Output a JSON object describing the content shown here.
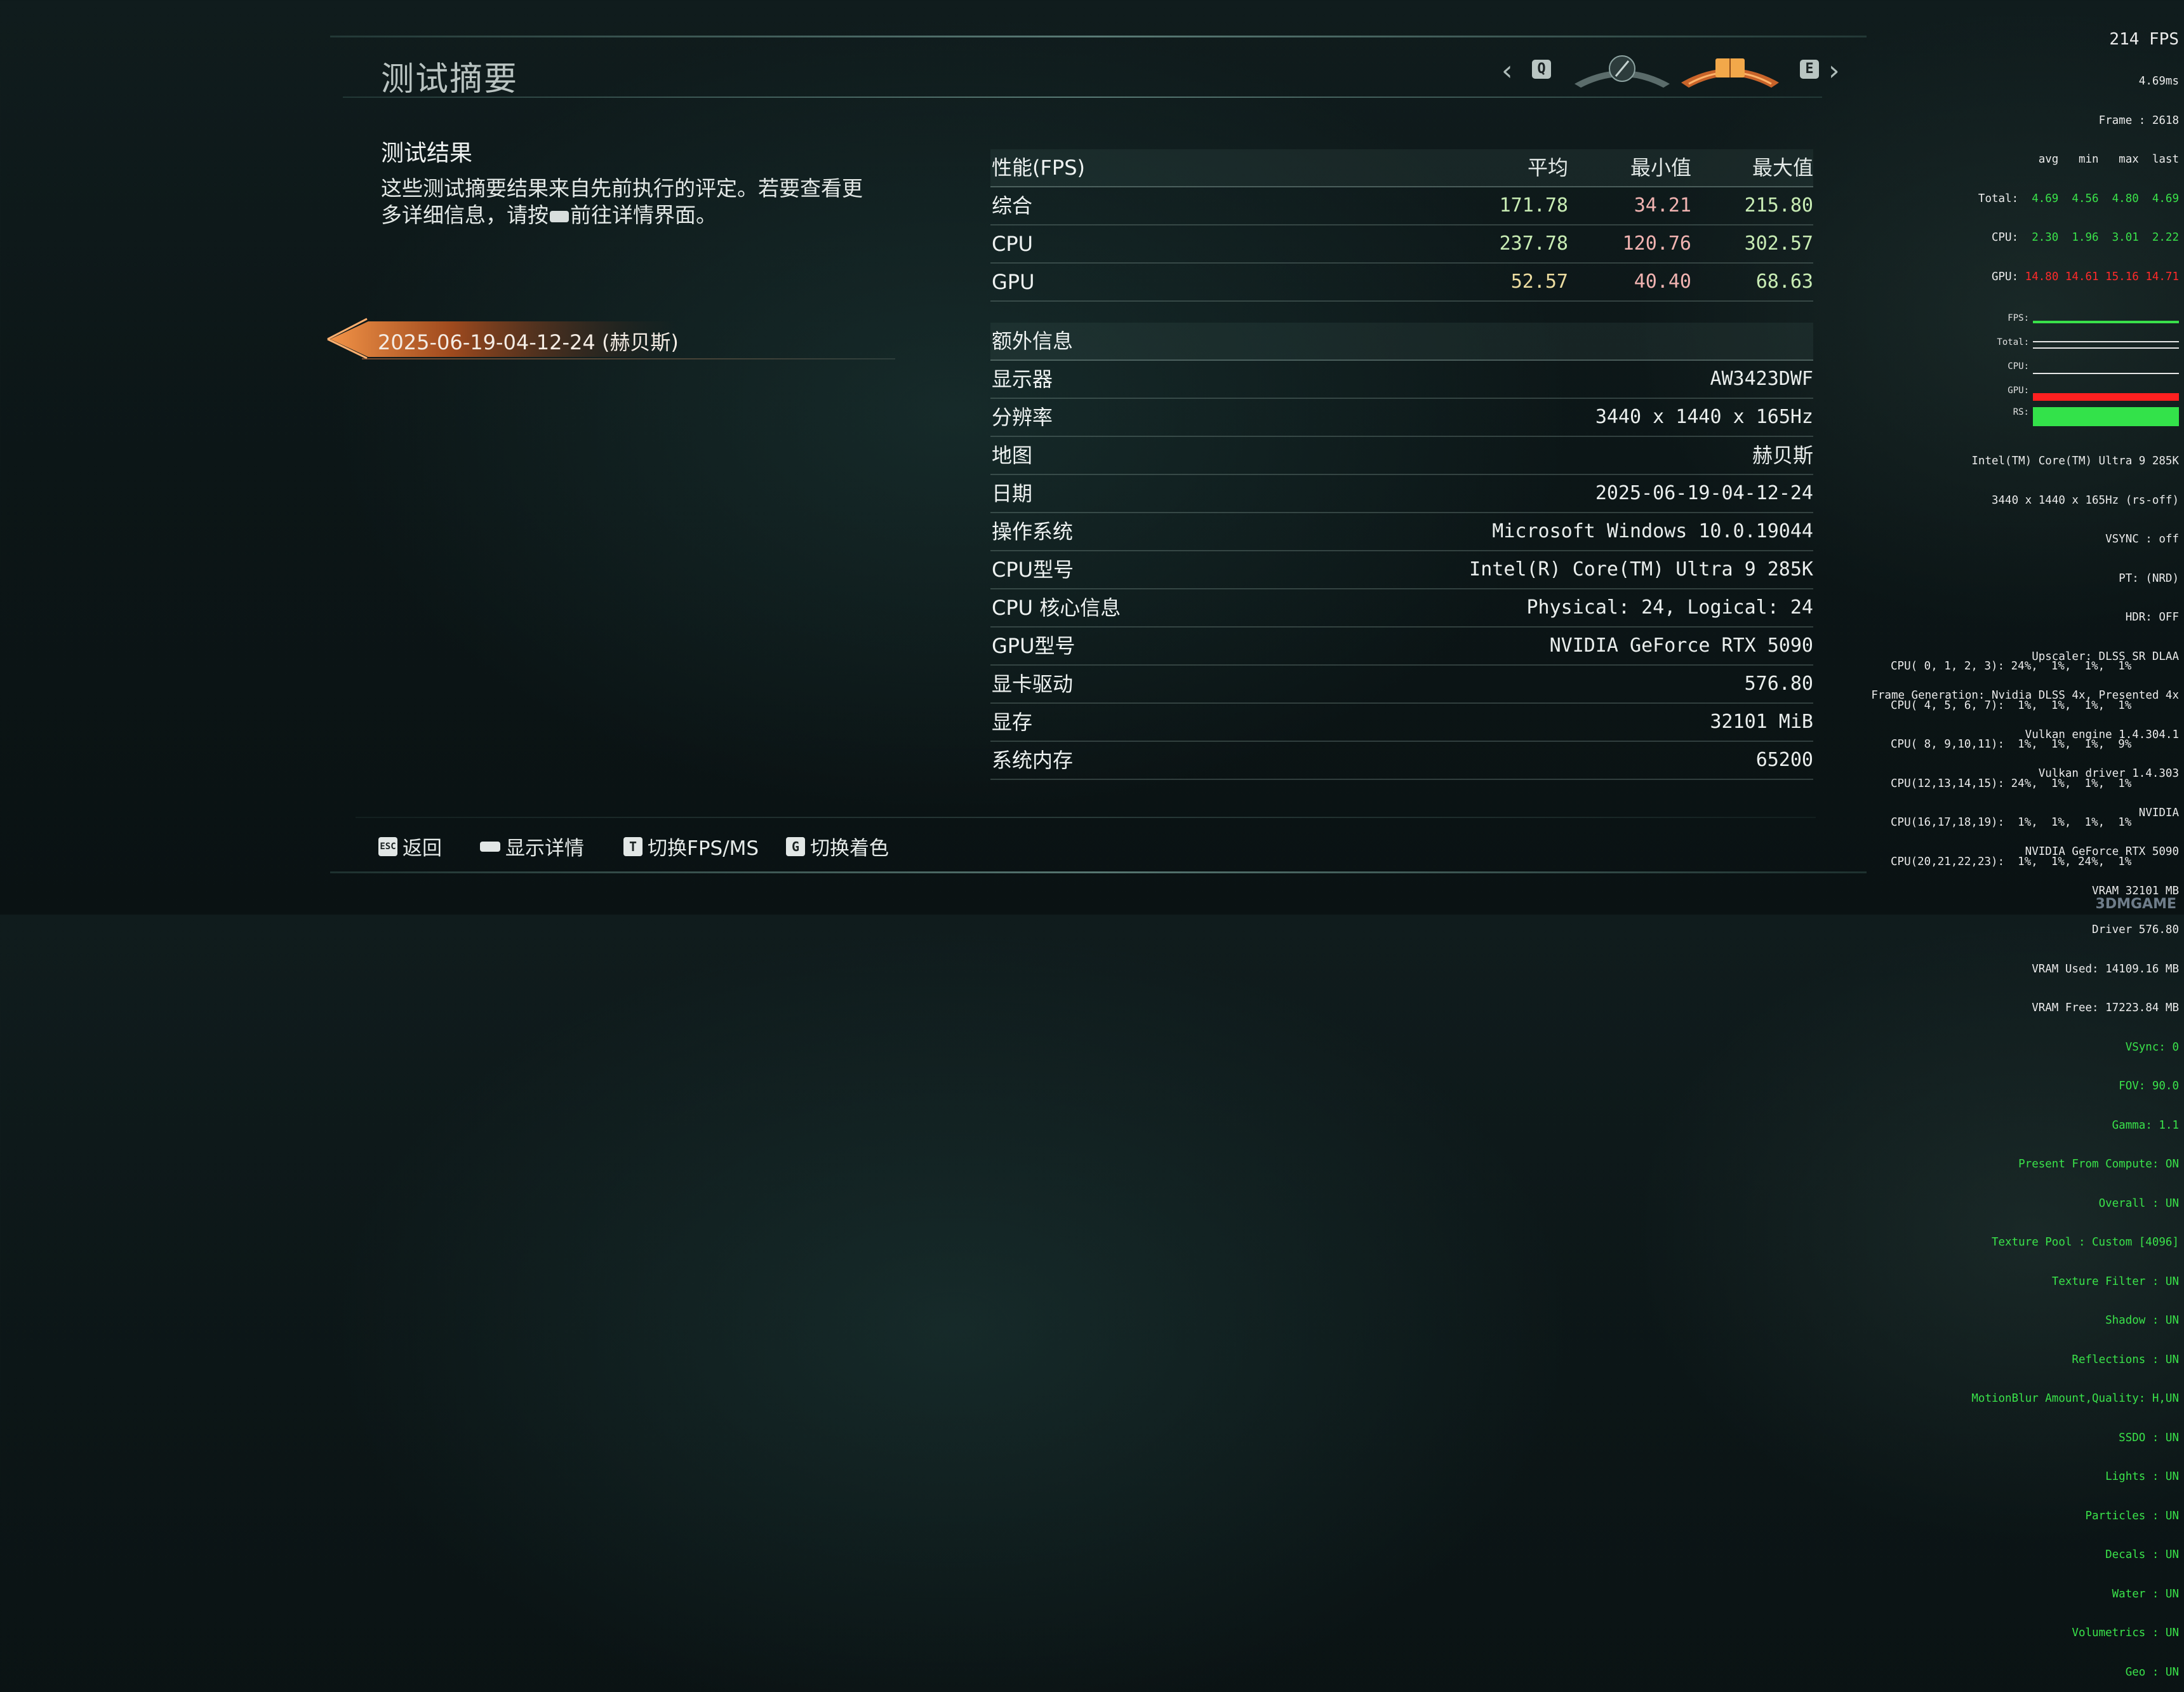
{
  "header": {
    "title": "测试摘要",
    "nav_prev_key": "Q",
    "nav_next_key": "E"
  },
  "results": {
    "title": "测试结果",
    "desc_before": "这些测试摘要结果来自先前执行的评定。若要查看更多详细信息，请按",
    "desc_after": "前往详情界面。"
  },
  "session": {
    "label": "2025-06-19-04-12-24 (赫贝斯)"
  },
  "performance": {
    "header": {
      "label": "性能(FPS)",
      "avg": "平均",
      "min": "最小值",
      "max": "最大值"
    },
    "rows": [
      {
        "label": "综合",
        "avg": "171.78",
        "min": "34.21",
        "max": "215.80"
      },
      {
        "label": "CPU",
        "avg": "237.78",
        "min": "120.76",
        "max": "302.57"
      },
      {
        "label": "GPU",
        "avg": "52.57",
        "min": "40.40",
        "max": "68.63"
      }
    ]
  },
  "extra": {
    "header": "额外信息",
    "rows": [
      {
        "label": "显示器",
        "value": "AW3423DWF"
      },
      {
        "label": "分辨率",
        "value": "3440 x 1440 x 165Hz"
      },
      {
        "label": "地图",
        "value": "赫贝斯"
      },
      {
        "label": "日期",
        "value": "2025-06-19-04-12-24"
      },
      {
        "label": "操作系统",
        "value": "Microsoft Windows 10.0.19044"
      },
      {
        "label": "CPU型号",
        "value": "Intel(R) Core(TM) Ultra 9 285K"
      },
      {
        "label": "CPU 核心信息",
        "value": "Physical: 24, Logical: 24"
      },
      {
        "label": "GPU型号",
        "value": "NVIDIA GeForce RTX 5090"
      },
      {
        "label": "显卡驱动",
        "value": "576.80"
      },
      {
        "label": "显存",
        "value": "32101 MiB"
      },
      {
        "label": "系统内存",
        "value": "65200"
      }
    ]
  },
  "footer": {
    "back": {
      "key": "ESC",
      "label": "返回"
    },
    "details": {
      "label": "显示详情"
    },
    "toggle_fps": {
      "key": "T",
      "label": "切换FPS/MS"
    },
    "toggle_color": {
      "key": "G",
      "label": "切换着色"
    }
  },
  "overlay": {
    "fps": "214 FPS",
    "frametime": "4.69ms",
    "frame": "Frame : 2618",
    "stats_header": "avg   min   max  last",
    "stats": [
      {
        "label": "Total:",
        "values": "4.69  4.56  4.80  4.69"
      },
      {
        "label": "CPU:",
        "values": "2.30  1.96  3.01  2.22"
      },
      {
        "label": "GPU:",
        "values": "14.80 14.61 15.16 14.71"
      }
    ],
    "graph_labels": [
      "FPS:",
      "Total:",
      "CPU:",
      "GPU:",
      "RS:"
    ],
    "info_white": [
      "Intel(TM) Core(TM) Ultra 9 285K",
      "3440 x 1440 x 165Hz (rs-off)",
      "VSYNC : off",
      "PT: (NRD)",
      "HDR: OFF",
      "Upscaler: DLSS SR DLAA",
      "Frame Generation: Nvidia DLSS 4x, Presented 4x",
      "Vulkan engine 1.4.304.1",
      "Vulkan driver 1.4.303",
      "NVIDIA",
      "NVIDIA GeForce RTX 5090",
      "VRAM 32101 MB",
      "Driver 576.80",
      "VRAM Used: 14109.16 MB",
      "VRAM Free: 17223.84 MB"
    ],
    "info_green": [
      "VSync: 0",
      "FOV: 90.0",
      "Gamma: 1.1",
      "Present From Compute: ON",
      "Overall : UN",
      "Texture Pool : Custom [4096]",
      "Texture Filter : UN",
      "Shadow : UN",
      "Reflections : UN",
      "MotionBlur Amount,Quality: H,UN",
      "SSDO : UN",
      "Lights : UN",
      "Particles : UN",
      "Decals : UN",
      "Water : UN",
      "Volumetrics : UN",
      "Geo : UN"
    ],
    "cpu_cores": [
      "CPU( 0, 1, 2, 3): 24%,  1%,  1%,  1%",
      "CPU( 4, 5, 6, 7):  1%,  1%,  1%,  1%",
      "CPU( 8, 9,10,11):  1%,  1%,  1%,  9%",
      "CPU(12,13,14,15): 24%,  1%,  1%,  1%",
      "CPU(16,17,18,19):  1%,  1%,  1%,  1%",
      "CPU(20,21,22,23):  1%,  1%, 24%,  1%"
    ],
    "watermark": "3DMGAME"
  },
  "colors": {
    "accent_orange": "#e0823f",
    "value_green": "#c8ecb4",
    "value_red": "#f1b3b1",
    "value_yellow": "#ecdca0",
    "overlay_green": "#3ae34a",
    "overlay_red": "#ff2a2a"
  },
  "icons": {
    "nav_prev": "chevron-left-icon",
    "nav_next": "chevron-right-icon",
    "nav_emblem_left": "compass-icon",
    "nav_emblem_active": "book-icon"
  }
}
